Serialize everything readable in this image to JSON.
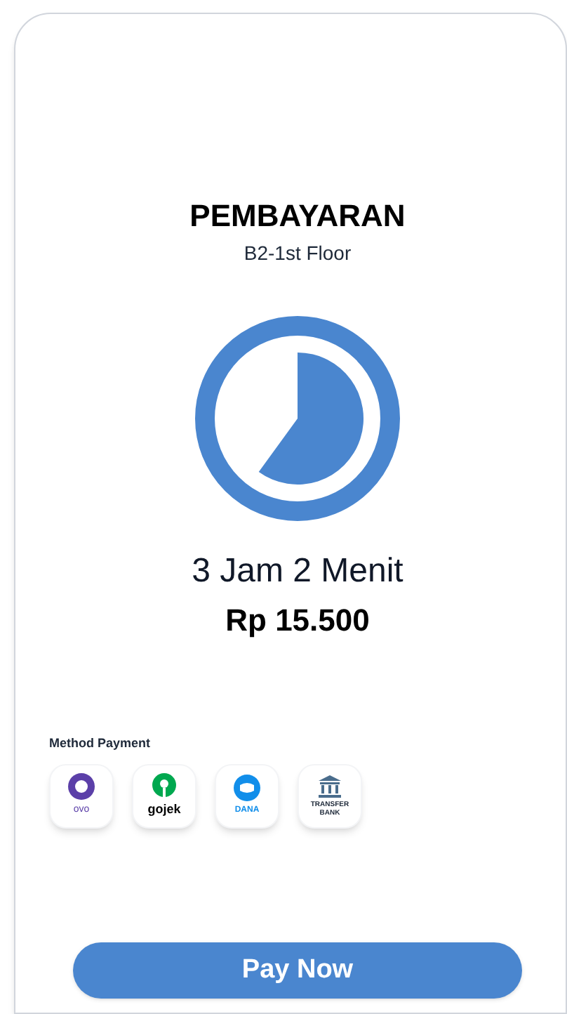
{
  "title": "PEMBAYARAN",
  "subtitle": "B2-1st Floor",
  "duration": "3 Jam 2 Menit",
  "price": "Rp 15.500",
  "payment": {
    "label": "Method Payment",
    "methods": [
      {
        "kind": "ovo",
        "label": "ovo"
      },
      {
        "kind": "gojek",
        "label": "gojek"
      },
      {
        "kind": "dana",
        "label": "DANA"
      },
      {
        "kind": "bank",
        "label": "TRANSFER BANK"
      }
    ]
  },
  "button": "Pay Now"
}
